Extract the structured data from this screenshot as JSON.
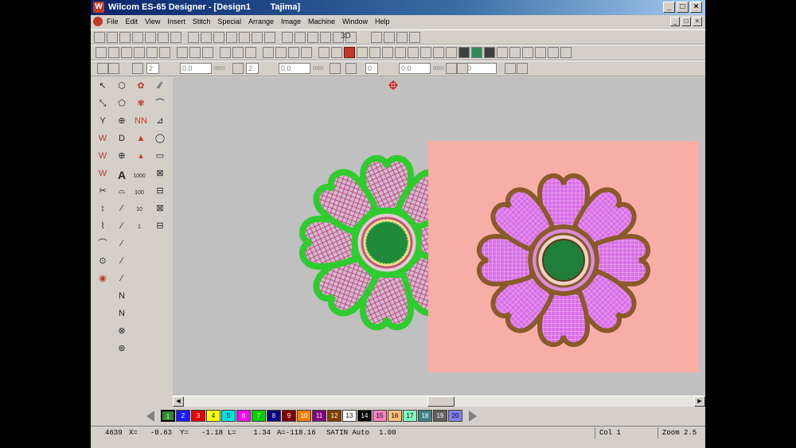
{
  "window": {
    "title": "Wilcom ES-65 Designer - [Design1",
    "title_machine": "Tajima]"
  },
  "menu": [
    "File",
    "Edit",
    "View",
    "Insert",
    "Stitch",
    "Special",
    "Arrange",
    "Image",
    "Machine",
    "Window",
    "Help"
  ],
  "toolbar": {
    "fields": [
      "2",
      "0.0",
      "mm",
      "2",
      "0.0",
      "mm",
      "0",
      "0.0",
      "mm",
      "0"
    ],
    "label_3d": "3D"
  },
  "left_tools": {
    "text_tool": "A",
    "count_1000": "1000",
    "count_100": "100",
    "count_10": "10",
    "count_1": "1"
  },
  "palette": {
    "swatches": [
      {
        "n": "1",
        "color": "#2e8b2e"
      },
      {
        "n": "2",
        "color": "#1a1aff"
      },
      {
        "n": "3",
        "color": "#e00000"
      },
      {
        "n": "4",
        "color": "#ffff00"
      },
      {
        "n": "5",
        "color": "#00e0e0"
      },
      {
        "n": "6",
        "color": "#ff00ff"
      },
      {
        "n": "7",
        "color": "#00cc00"
      },
      {
        "n": "8",
        "color": "#000080"
      },
      {
        "n": "9",
        "color": "#800000"
      },
      {
        "n": "10",
        "color": "#ff8000"
      },
      {
        "n": "11",
        "color": "#800080"
      },
      {
        "n": "12",
        "color": "#804000"
      },
      {
        "n": "13",
        "color": "#ffffff"
      },
      {
        "n": "14",
        "color": "#000000"
      },
      {
        "n": "15",
        "color": "#ff80c0"
      },
      {
        "n": "16",
        "color": "#ffc080"
      },
      {
        "n": "17",
        "color": "#80ffc0"
      },
      {
        "n": "18",
        "color": "#408080"
      },
      {
        "n": "19",
        "color": "#606060"
      },
      {
        "n": "20",
        "color": "#8080ff"
      }
    ]
  },
  "status": {
    "count": "4639",
    "x": "X=   -0.63",
    "y": "Y=   -1.18",
    "l": "L=    1.34",
    "a": "A=-118.16",
    "stitch": "SATIN Auto",
    "value": "1.00",
    "col": "Col 1",
    "zoom": "Zoom 2.5"
  },
  "colors": {
    "canvas": "#c0c0c0",
    "embroidery_outline": "#2ecc2e",
    "petal_fill": "#d8b0cc",
    "photo_bg": "#f6aea6",
    "photo_petal": "#d070e0",
    "photo_outline": "#8a5a2a",
    "center": "#1e8a3a"
  }
}
